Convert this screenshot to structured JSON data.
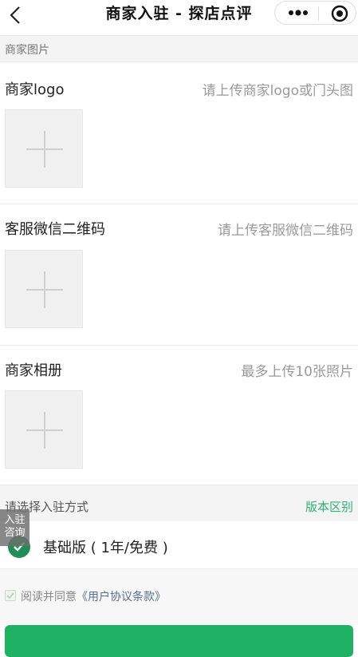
{
  "nav": {
    "title": "商家入驻 - 探店点评"
  },
  "section": {
    "title": "商家图片"
  },
  "uploads": [
    {
      "label": "商家logo",
      "hint": "请上传商家logo或门头图"
    },
    {
      "label": "客服微信二维码",
      "hint": "请上传客服微信二维码"
    },
    {
      "label": "商家相册",
      "hint": "最多上传10张照片"
    }
  ],
  "mode": {
    "label": "请选择入驻方式",
    "version_link": "版本区别",
    "selected_plan": "基础版 ( 1年/免费 )"
  },
  "float_badge": {
    "line1": "入驻",
    "line2": "咨询"
  },
  "agreement": {
    "prefix": "阅读并同意",
    "link": "《用户协议条款》"
  },
  "colors": {
    "accent": "#2db474",
    "check": "#1f8d55"
  }
}
